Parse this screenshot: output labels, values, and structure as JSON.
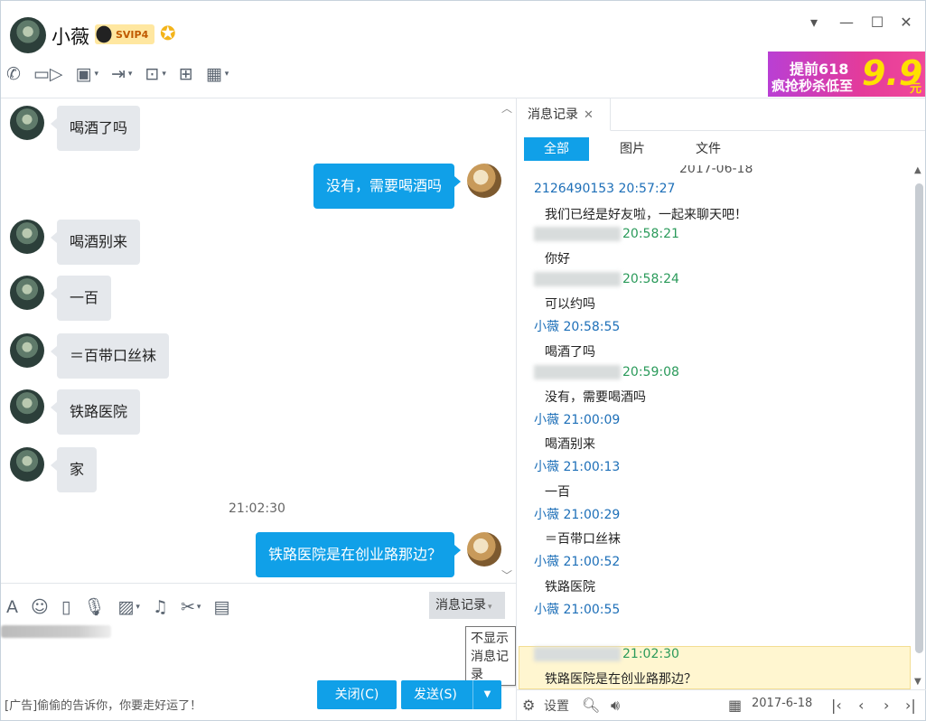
{
  "header": {
    "contact_name": "小薇",
    "vip_label": "SVIP4",
    "toolbar_icons": [
      "phone-icon",
      "video-icon",
      "screen-share-icon",
      "file-transfer-icon",
      "remote-desktop-icon",
      "add-icon",
      "apps-icon"
    ],
    "window_buttons": {
      "dropdown": "▾",
      "minimize": "—",
      "maximize": "☐",
      "close": "✕"
    }
  },
  "ad_banner": {
    "line1": "提前618",
    "line2": "疯抢秒杀低至",
    "price": "9.9",
    "unit": "元"
  },
  "chat": {
    "messages": [
      {
        "dir": "in",
        "text": "喝酒了吗"
      },
      {
        "dir": "out",
        "text": "没有，需要喝酒吗"
      },
      {
        "dir": "in",
        "text": "喝酒别来"
      },
      {
        "dir": "in",
        "text": "一百"
      },
      {
        "dir": "in",
        "text": "＝百带口丝袜"
      },
      {
        "dir": "in",
        "text": "铁路医院"
      },
      {
        "dir": "in",
        "text": "家"
      },
      {
        "dir": "out",
        "text": "铁路医院是在创业路那边？"
      }
    ],
    "timestamp": "21:02:30"
  },
  "input": {
    "history_button": "消息记录",
    "tooltip": "不显示消息记录",
    "ad_text": "[广告]偷偷的告诉你，你要走好运了！",
    "close_button": "关闭(C)",
    "send_button": "发送(S)"
  },
  "history": {
    "tab_title": "消息记录",
    "subtabs": [
      "全部",
      "图片",
      "文件"
    ],
    "top_partial": "2017-06-18",
    "entries": [
      {
        "name": "2126490153 20:57:27",
        "color": "blue",
        "msg": "我们已经是好友啦，一起来聊天吧！"
      },
      {
        "name": "20:58:21",
        "color": "green",
        "blur": true,
        "msg": "你好"
      },
      {
        "name": "20:58:24",
        "color": "green",
        "blur": true,
        "msg": "可以约吗"
      },
      {
        "name": "小薇 20:58:55",
        "color": "blue",
        "msg": "喝酒了吗"
      },
      {
        "name": "20:59:08",
        "color": "green",
        "blur": true,
        "msg": "没有，需要喝酒吗"
      },
      {
        "name": "小薇 21:00:09",
        "color": "blue",
        "msg": "喝酒别来"
      },
      {
        "name": "小薇 21:00:13",
        "color": "blue",
        "msg": "一百"
      },
      {
        "name": "小薇 21:00:29",
        "color": "blue",
        "msg": "＝百带口丝袜"
      },
      {
        "name": "小薇 21:00:52",
        "color": "blue",
        "msg": "铁路医院"
      },
      {
        "name": "小薇 21:00:55",
        "color": "blue",
        "msg": ""
      },
      {
        "name": "21:02:30",
        "color": "green",
        "blur": true,
        "msg": "铁路医院是在创业路那边？"
      }
    ],
    "footer": {
      "settings": "设置",
      "date": "2017-6-18"
    }
  }
}
